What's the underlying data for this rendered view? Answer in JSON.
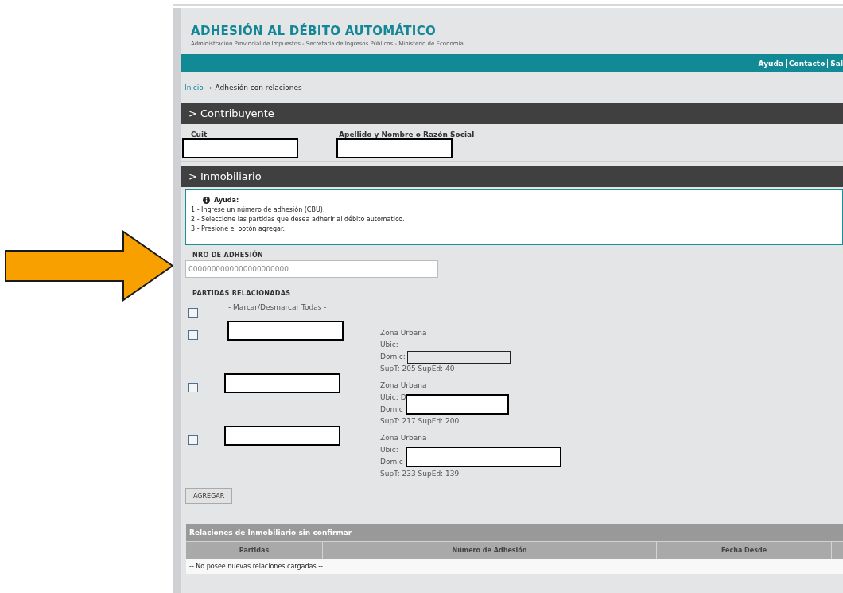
{
  "header": {
    "title": "ADHESIÓN AL DÉBITO AUTOMÁTICO",
    "subtitle": "Administración Provincial de Impuestos - Secretaría de Ingresos Públicos - Ministerio de Economía"
  },
  "nav_links": [
    "Ayuda",
    "Contacto",
    "Sal"
  ],
  "breadcrumb": {
    "link": "Inicio",
    "separator": "→",
    "current": "Adhesión con relaciones"
  },
  "contribuyente": {
    "heading": "> Contribuyente",
    "fields": [
      {
        "label": "Cuit"
      },
      {
        "label": "Apellido y Nombre o Razón Social"
      }
    ]
  },
  "inmobiliario": {
    "heading": "> Inmobiliario",
    "help": {
      "title": "Ayuda:",
      "lines": [
        "1 - Ingrese un número de adhesión (CBU).",
        "2 - Seleccione las partidas que desea adherir al débito automatico.",
        "3 - Presione el botón agregar."
      ]
    },
    "adhesion_label": "NRO DE ADHESIÓN",
    "adhesion_placeholder": "0000000000000000000000",
    "partidas_label": "PARTIDAS RELACIONADAS",
    "select_all": {
      "label": "- Marcar/Desmarcar Todas -",
      "checked": false
    },
    "partidas": [
      {
        "checked": false,
        "zona": "Zona Urbana",
        "ubic": "Ubic:",
        "domic": "Domic:",
        "sup": "SupT: 205 SupEd: 40"
      },
      {
        "checked": false,
        "zona": "Zona Urbana",
        "ubic": "Ubic: D",
        "domic": "Domic",
        "sup": "SupT: 217 SupEd: 200"
      },
      {
        "checked": false,
        "zona": "Zona Urbana",
        "ubic": "Ubic:",
        "domic": "Domic",
        "sup": "SupT: 233 SupEd: 139"
      }
    ],
    "add_button": "AGREGAR"
  },
  "table": {
    "title": "Relaciones de Inmobiliario sin confirmar",
    "columns": [
      "Partidas",
      "Número de Adhesión",
      "Fecha Desde"
    ],
    "empty_message": "-- No posee nuevas relaciones cargadas --"
  }
}
